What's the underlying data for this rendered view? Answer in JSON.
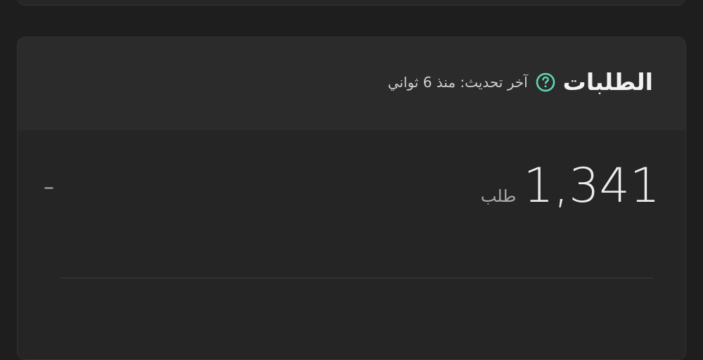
{
  "requests_card": {
    "title": "الطلبات",
    "help_icon": "question-circle-icon",
    "updated_text": "آخر تحديث: منذ 6 ثواني",
    "metric": {
      "value": "1,341",
      "unit": "طلب",
      "trend": "–"
    }
  },
  "colors": {
    "background": "#1f1e1f",
    "card_header": "#2c2b2c",
    "card_body": "#262526",
    "accent": "#5fd8b4"
  }
}
